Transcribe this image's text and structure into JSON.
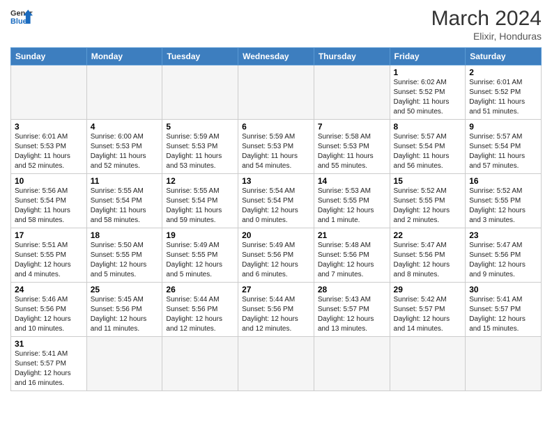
{
  "header": {
    "logo_general": "General",
    "logo_blue": "Blue",
    "month_year": "March 2024",
    "location": "Elixir, Honduras"
  },
  "days_of_week": [
    "Sunday",
    "Monday",
    "Tuesday",
    "Wednesday",
    "Thursday",
    "Friday",
    "Saturday"
  ],
  "weeks": [
    [
      {
        "day": "",
        "info": ""
      },
      {
        "day": "",
        "info": ""
      },
      {
        "day": "",
        "info": ""
      },
      {
        "day": "",
        "info": ""
      },
      {
        "day": "",
        "info": ""
      },
      {
        "day": "1",
        "info": "Sunrise: 6:02 AM\nSunset: 5:52 PM\nDaylight: 11 hours and 50 minutes."
      },
      {
        "day": "2",
        "info": "Sunrise: 6:01 AM\nSunset: 5:52 PM\nDaylight: 11 hours and 51 minutes."
      }
    ],
    [
      {
        "day": "3",
        "info": "Sunrise: 6:01 AM\nSunset: 5:53 PM\nDaylight: 11 hours and 52 minutes."
      },
      {
        "day": "4",
        "info": "Sunrise: 6:00 AM\nSunset: 5:53 PM\nDaylight: 11 hours and 52 minutes."
      },
      {
        "day": "5",
        "info": "Sunrise: 5:59 AM\nSunset: 5:53 PM\nDaylight: 11 hours and 53 minutes."
      },
      {
        "day": "6",
        "info": "Sunrise: 5:59 AM\nSunset: 5:53 PM\nDaylight: 11 hours and 54 minutes."
      },
      {
        "day": "7",
        "info": "Sunrise: 5:58 AM\nSunset: 5:53 PM\nDaylight: 11 hours and 55 minutes."
      },
      {
        "day": "8",
        "info": "Sunrise: 5:57 AM\nSunset: 5:54 PM\nDaylight: 11 hours and 56 minutes."
      },
      {
        "day": "9",
        "info": "Sunrise: 5:57 AM\nSunset: 5:54 PM\nDaylight: 11 hours and 57 minutes."
      }
    ],
    [
      {
        "day": "10",
        "info": "Sunrise: 5:56 AM\nSunset: 5:54 PM\nDaylight: 11 hours and 58 minutes."
      },
      {
        "day": "11",
        "info": "Sunrise: 5:55 AM\nSunset: 5:54 PM\nDaylight: 11 hours and 58 minutes."
      },
      {
        "day": "12",
        "info": "Sunrise: 5:55 AM\nSunset: 5:54 PM\nDaylight: 11 hours and 59 minutes."
      },
      {
        "day": "13",
        "info": "Sunrise: 5:54 AM\nSunset: 5:54 PM\nDaylight: 12 hours and 0 minutes."
      },
      {
        "day": "14",
        "info": "Sunrise: 5:53 AM\nSunset: 5:55 PM\nDaylight: 12 hours and 1 minute."
      },
      {
        "day": "15",
        "info": "Sunrise: 5:52 AM\nSunset: 5:55 PM\nDaylight: 12 hours and 2 minutes."
      },
      {
        "day": "16",
        "info": "Sunrise: 5:52 AM\nSunset: 5:55 PM\nDaylight: 12 hours and 3 minutes."
      }
    ],
    [
      {
        "day": "17",
        "info": "Sunrise: 5:51 AM\nSunset: 5:55 PM\nDaylight: 12 hours and 4 minutes."
      },
      {
        "day": "18",
        "info": "Sunrise: 5:50 AM\nSunset: 5:55 PM\nDaylight: 12 hours and 5 minutes."
      },
      {
        "day": "19",
        "info": "Sunrise: 5:49 AM\nSunset: 5:55 PM\nDaylight: 12 hours and 5 minutes."
      },
      {
        "day": "20",
        "info": "Sunrise: 5:49 AM\nSunset: 5:56 PM\nDaylight: 12 hours and 6 minutes."
      },
      {
        "day": "21",
        "info": "Sunrise: 5:48 AM\nSunset: 5:56 PM\nDaylight: 12 hours and 7 minutes."
      },
      {
        "day": "22",
        "info": "Sunrise: 5:47 AM\nSunset: 5:56 PM\nDaylight: 12 hours and 8 minutes."
      },
      {
        "day": "23",
        "info": "Sunrise: 5:47 AM\nSunset: 5:56 PM\nDaylight: 12 hours and 9 minutes."
      }
    ],
    [
      {
        "day": "24",
        "info": "Sunrise: 5:46 AM\nSunset: 5:56 PM\nDaylight: 12 hours and 10 minutes."
      },
      {
        "day": "25",
        "info": "Sunrise: 5:45 AM\nSunset: 5:56 PM\nDaylight: 12 hours and 11 minutes."
      },
      {
        "day": "26",
        "info": "Sunrise: 5:44 AM\nSunset: 5:56 PM\nDaylight: 12 hours and 12 minutes."
      },
      {
        "day": "27",
        "info": "Sunrise: 5:44 AM\nSunset: 5:56 PM\nDaylight: 12 hours and 12 minutes."
      },
      {
        "day": "28",
        "info": "Sunrise: 5:43 AM\nSunset: 5:57 PM\nDaylight: 12 hours and 13 minutes."
      },
      {
        "day": "29",
        "info": "Sunrise: 5:42 AM\nSunset: 5:57 PM\nDaylight: 12 hours and 14 minutes."
      },
      {
        "day": "30",
        "info": "Sunrise: 5:41 AM\nSunset: 5:57 PM\nDaylight: 12 hours and 15 minutes."
      }
    ],
    [
      {
        "day": "31",
        "info": "Sunrise: 5:41 AM\nSunset: 5:57 PM\nDaylight: 12 hours and 16 minutes."
      },
      {
        "day": "",
        "info": ""
      },
      {
        "day": "",
        "info": ""
      },
      {
        "day": "",
        "info": ""
      },
      {
        "day": "",
        "info": ""
      },
      {
        "day": "",
        "info": ""
      },
      {
        "day": "",
        "info": ""
      }
    ]
  ]
}
